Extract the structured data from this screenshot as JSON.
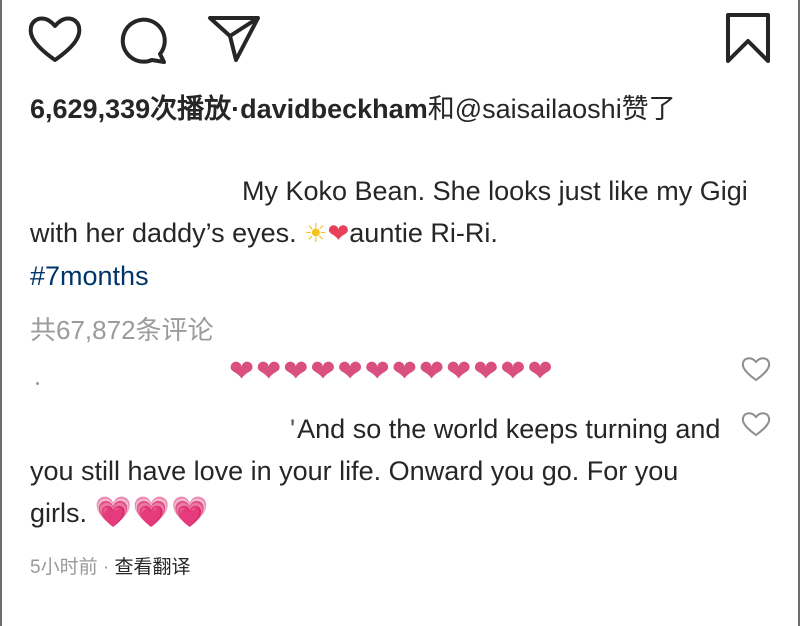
{
  "actions": {
    "like_icon": "heart-outline-icon",
    "comment_icon": "speech-bubble-icon",
    "share_icon": "paper-plane-icon",
    "save_icon": "bookmark-icon"
  },
  "stats": {
    "views": "6,629,339次播放",
    "separator": "·",
    "liked_by_user": "davidbeckham",
    "liked_by_conjunction": "和",
    "liked_by_other": "@saisailaoshi赞了"
  },
  "caption": {
    "text": "My Koko Bean. She looks just like my Gigi with her daddy’s eyes.",
    "sun_emoji": "☀",
    "heart_emoji": "❤",
    "tail": "auntie Ri-Ri.",
    "hashtag": "#7months"
  },
  "comments_total": "共67,872条评论",
  "comment1": {
    "hearts": "❤❤❤❤❤❤❤❤❤❤❤❤"
  },
  "comment2": {
    "tick": "'",
    "text": "And so the world keeps turning and you still have love in your life. Onward you go. For you girls.",
    "hearts": "💗💗💗"
  },
  "meta": {
    "time": "5小时前",
    "dot": "·",
    "translate": "查看翻译"
  },
  "colors": {
    "hashtag": "#003569",
    "muted": "#9b9b9b",
    "heart_pink": "#d94f80"
  }
}
